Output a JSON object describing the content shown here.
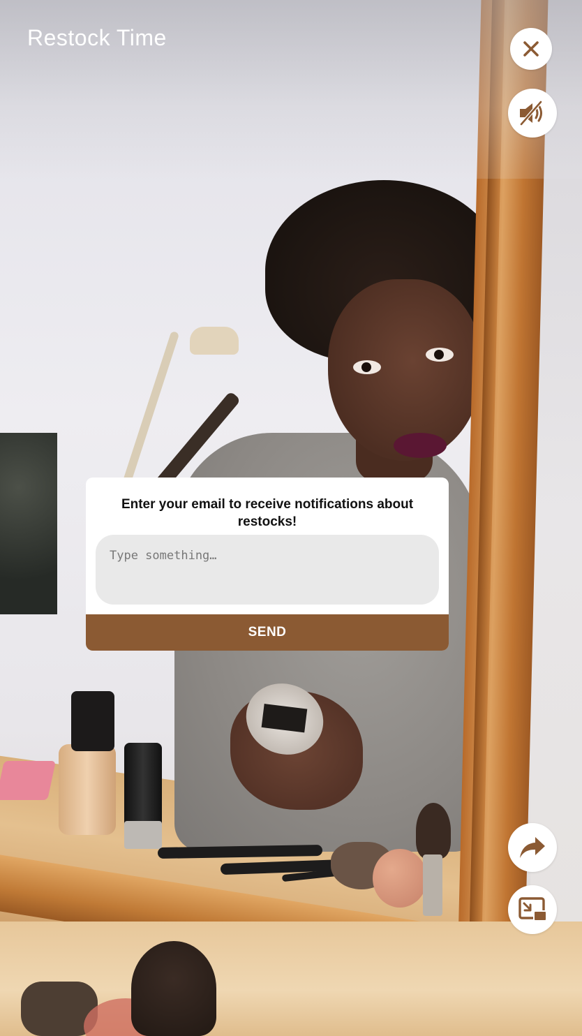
{
  "header": {
    "title": "Restock Time"
  },
  "controls": {
    "close_icon": "close-icon",
    "mute_icon": "speaker-muted-icon",
    "share_icon": "share-arrow-icon",
    "pip_icon": "picture-in-picture-exit-icon"
  },
  "dialog": {
    "message": "Enter your email to receive notifications about restocks!",
    "input_placeholder": "Type something…",
    "input_value": "",
    "send_label": "SEND"
  },
  "colors": {
    "accent": "#8b5a33",
    "icon": "#8b5a33",
    "input_bg": "#e9e9e9",
    "dialog_bg": "#ffffff"
  }
}
